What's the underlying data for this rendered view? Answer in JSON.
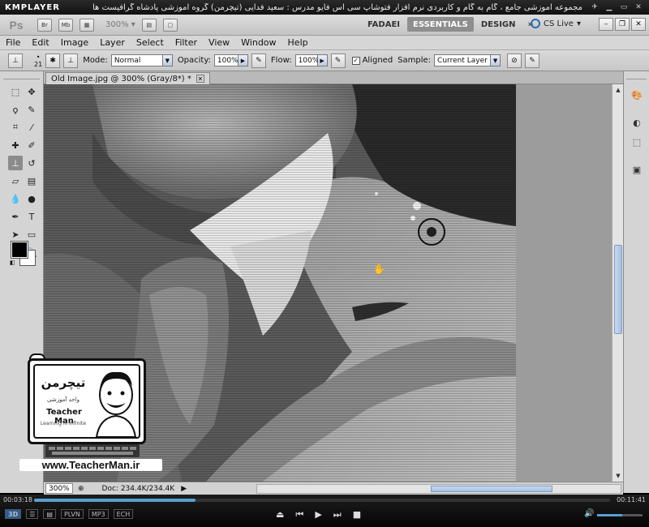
{
  "player": {
    "logo": "KMPLAYER",
    "title": "مجموعه آموزشی جامع ، گام به گام و کاربردی نرم افزار فتوشاپ سی اس فایو  مدرس : سعید فدایی (تیچرمن) گروه آموزشی پادشاه گرافیست ها",
    "time_elapsed": "00:03:18",
    "time_total": "00:11:41",
    "progress": 0.28,
    "volume": 0.55,
    "badges": [
      "3D",
      "PLVN",
      "MP3",
      "ECH"
    ]
  },
  "photoshop": {
    "logo": "Ps",
    "bridge_label": "Br",
    "minibridge_label": "Mb",
    "zoom_select": "300%",
    "workspaces": [
      "FADAEI",
      "ESSENTIALS",
      "DESIGN"
    ],
    "active_workspace": "ESSENTIALS",
    "cs_live": "CS Live",
    "menu": [
      "File",
      "Edit",
      "Image",
      "Layer",
      "Select",
      "Filter",
      "View",
      "Window",
      "Help"
    ]
  },
  "options": {
    "brush_size": "21",
    "mode_label": "Mode:",
    "mode_value": "Normal",
    "opacity_label": "Opacity:",
    "opacity_value": "100%",
    "flow_label": "Flow:",
    "flow_value": "100%",
    "aligned_label": "Aligned",
    "aligned_checked": true,
    "sample_label": "Sample:",
    "sample_value": "Current Layer"
  },
  "document": {
    "tab_title": "Old Image.jpg @ 300% (Gray/8*) *",
    "zoom": "300%",
    "doc_info": "Doc: 234.4K/234.4K"
  },
  "watermark": {
    "brand_fa": "تیچرمن",
    "sub_fa": "واحد آموزشی",
    "brand_en": "Teacher Man",
    "tagline": "Learning in Infinite",
    "url": "www.TeacherMan.ir"
  },
  "colors": {
    "foreground": "#000000",
    "background": "#ffffff",
    "accent": "#5a9fd0"
  }
}
